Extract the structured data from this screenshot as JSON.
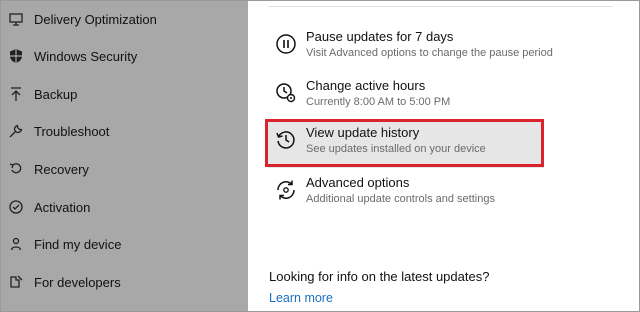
{
  "sidebar": {
    "items": [
      {
        "label": "Delivery Optimization",
        "icon": "delivery-optimization-icon"
      },
      {
        "label": "Windows Security",
        "icon": "shield-icon"
      },
      {
        "label": "Backup",
        "icon": "backup-arrow-icon"
      },
      {
        "label": "Troubleshoot",
        "icon": "wrench-icon"
      },
      {
        "label": "Recovery",
        "icon": "recovery-icon"
      },
      {
        "label": "Activation",
        "icon": "checkmark-circle-icon"
      },
      {
        "label": "Find my device",
        "icon": "person-pin-icon"
      },
      {
        "label": "For developers",
        "icon": "developer-tools-icon"
      }
    ]
  },
  "options": [
    {
      "title": "Pause updates for 7 days",
      "description": "Visit Advanced options to change the pause period",
      "icon": "pause-icon"
    },
    {
      "title": "Change active hours",
      "description": "Currently 8:00 AM to 5:00 PM",
      "icon": "clock-gear-icon"
    },
    {
      "title": "View update history",
      "description": "See updates installed on your device",
      "icon": "history-icon"
    },
    {
      "title": "Advanced options",
      "description": "Additional update controls and settings",
      "icon": "advanced-sync-icon"
    }
  ],
  "info": {
    "question": "Looking for info on the latest updates?",
    "link": "Learn more"
  },
  "colors": {
    "sidebar_bg": "#a8a8a8",
    "highlight_border": "#d9232f",
    "link": "#1a6fc4"
  }
}
